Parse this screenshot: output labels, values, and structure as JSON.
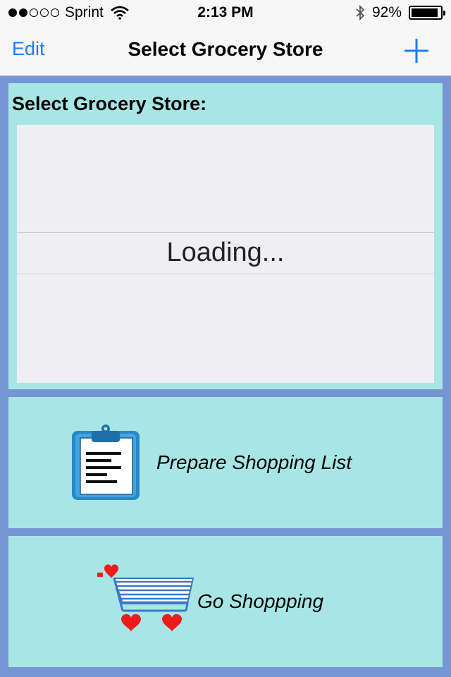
{
  "status_bar": {
    "carrier": "Sprint",
    "time": "2:13 PM",
    "battery_percent": "92%",
    "battery_level": 0.92,
    "signal_bars_filled": 2,
    "signal_bars_total": 5
  },
  "nav": {
    "edit_label": "Edit",
    "title": "Select Grocery Store",
    "add_icon": "plus-icon"
  },
  "store_picker": {
    "section_label": "Select Grocery Store:",
    "selected_value": "Loading..."
  },
  "actions": {
    "prepare_label": "Prepare Shopping List",
    "prepare_icon": "clipboard-icon",
    "shop_label": "Go Shoppping",
    "shop_icon": "shopping-cart-icon"
  },
  "colors": {
    "background": "#7596d2",
    "panel": "#a8e6e6",
    "accent": "#1a7ef8"
  }
}
